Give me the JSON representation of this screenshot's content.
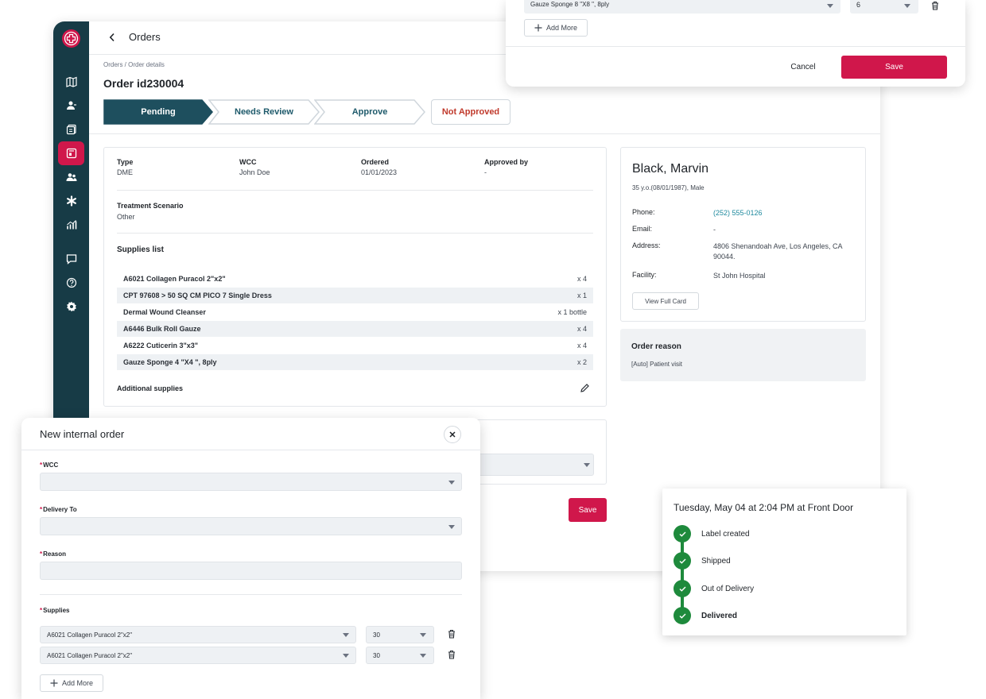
{
  "app": {
    "topbar_title": "Orders",
    "breadcrumb": "Orders / Order details",
    "page_title": "Order id230004",
    "stepper": [
      "Pending",
      "Needs Review",
      "Approve",
      "Not Approved"
    ],
    "accent_color": "#d0174b",
    "sidebar_color": "#173b46"
  },
  "order": {
    "fields": [
      {
        "label": "Type",
        "value": "DME"
      },
      {
        "label": "WCC",
        "value": "John Doe"
      },
      {
        "label": "Ordered",
        "value": "01/01/2023"
      },
      {
        "label": "Approved by",
        "value": "-"
      }
    ],
    "treatment_label": "Treatment Scenario",
    "treatment_value": "Other",
    "supplies_title": "Supplies list",
    "supplies": [
      {
        "name": "A6021 Collagen Puracol 2\"x2\"",
        "qty": "x 4"
      },
      {
        "name": "CPT 97608 > 50 SQ CM PICO 7 Single Dress",
        "qty": "x 1"
      },
      {
        "name": "Dermal Wound Cleanser",
        "qty": "x 1 bottle"
      },
      {
        "name": "A6446 Bulk Roll Gauze",
        "qty": "x 4"
      },
      {
        "name": "A6222 Cuticerin 3\"x3\"",
        "qty": "x 4"
      },
      {
        "name": "Gauze Sponge 4 \"X4 \", 8ply",
        "qty": "x 2"
      }
    ],
    "additional_label": "Additional supplies",
    "save_label": "Save"
  },
  "patient": {
    "name": "Black, Marvin",
    "sub": "35 y.o.(08/01/1987), Male",
    "rows": [
      {
        "label": "Phone:",
        "value": "(252) 555-0126"
      },
      {
        "label": "Email:",
        "value": "-"
      },
      {
        "label": "Address:",
        "value": "4806 Shenandoah Ave, Los Angeles, CA 90044."
      },
      {
        "label": "Facility:",
        "value": "St John Hospital"
      }
    ],
    "view_card_label": "View Full Card"
  },
  "reason": {
    "title": "Order reason",
    "value": "[Auto] Patient visit"
  },
  "top_overlay": {
    "supply_value": "Gauze Sponge 8 \"X8 \", 8ply",
    "qty_value": "6",
    "add_more_label": "Add More",
    "cancel_label": "Cancel",
    "save_label": "Save"
  },
  "modal": {
    "title": "New internal order",
    "wcc_label": "WCC",
    "delivery_label": "Delivery To",
    "reason_label": "Reason",
    "supplies_label": "Supplies",
    "supply_rows": [
      {
        "name": "A6021 Collagen Puracol 2\"x2\"",
        "qty": "30"
      },
      {
        "name": "A6021 Collagen Puracol 2\"x2\"",
        "qty": "30"
      }
    ],
    "add_more_label": "Add More"
  },
  "tracking": {
    "title": "Tuesday, May 04 at 2:04 PM at Front Door",
    "steps": [
      "Label created",
      "Shipped",
      "Out of Delivery",
      "Delivered"
    ],
    "status_color": "#1e8a3c"
  }
}
